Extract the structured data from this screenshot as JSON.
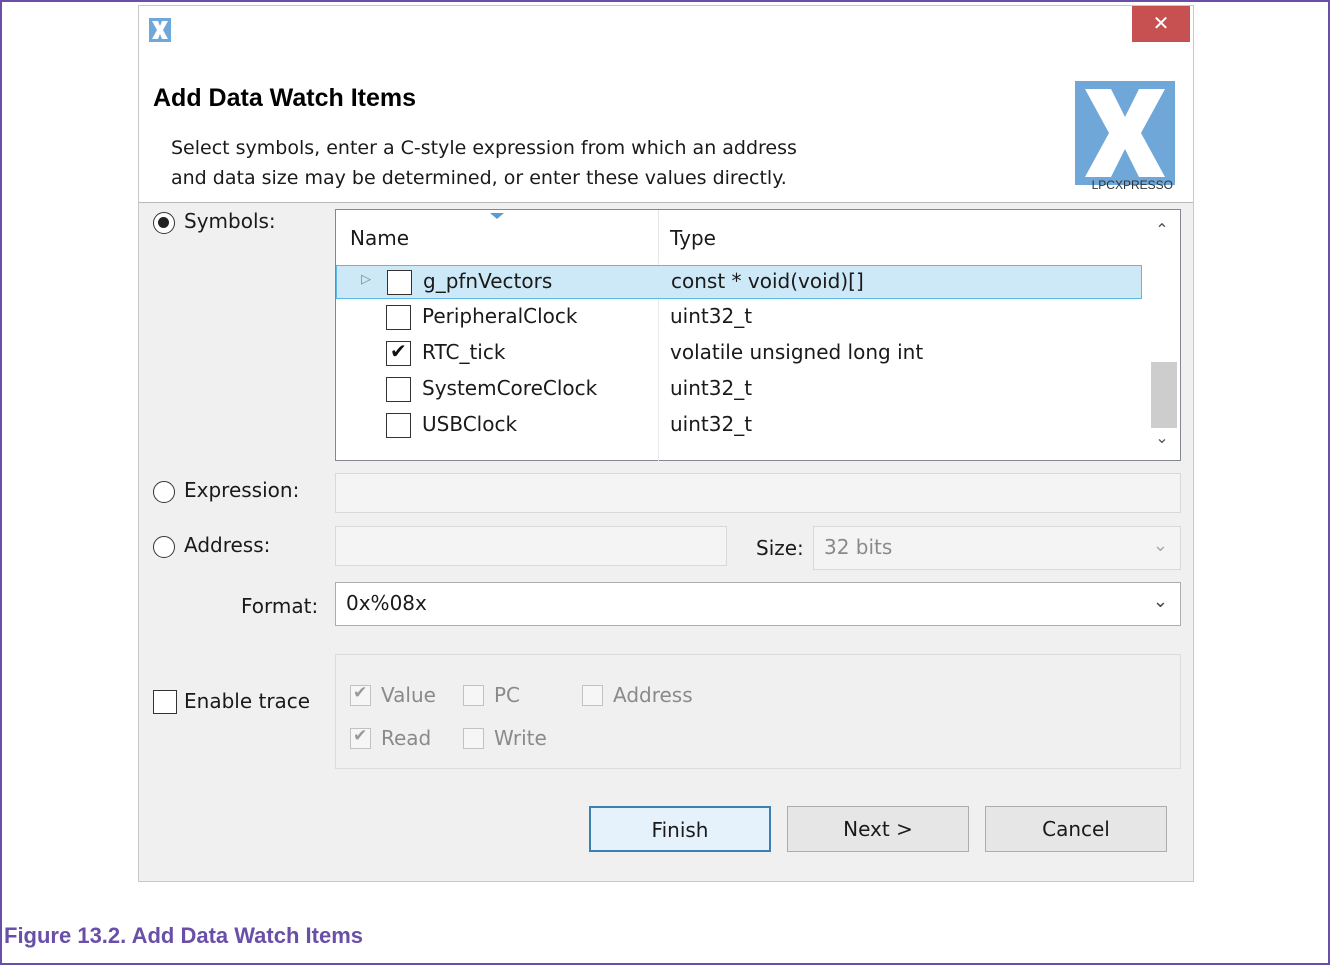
{
  "dialog": {
    "close_glyph": "✕",
    "header": {
      "title": "Add Data Watch Items",
      "description_line1": "Select symbols, enter a C-style expression from which an address",
      "description_line2": "and data size may be determined, or enter these values directly.",
      "brand_text": "LPCXPRESSO",
      "brand_color": "#6fa7d8"
    },
    "symbols": {
      "label": "Symbols:",
      "selected": true,
      "columns": [
        "Name",
        "Type"
      ],
      "rows": [
        {
          "name": "g_pfnVectors",
          "type": "const  * void(void)[]",
          "checked": false,
          "expandable": true,
          "selected": true
        },
        {
          "name": "PeripheralClock",
          "type": "uint32_t",
          "checked": false,
          "expandable": false,
          "selected": false
        },
        {
          "name": "RTC_tick",
          "type": "volatile unsigned long int",
          "checked": true,
          "expandable": false,
          "selected": false
        },
        {
          "name": "SystemCoreClock",
          "type": "uint32_t",
          "checked": false,
          "expandable": false,
          "selected": false
        },
        {
          "name": "USBClock",
          "type": "uint32_t",
          "checked": false,
          "expandable": false,
          "selected": false
        }
      ]
    },
    "expression": {
      "label": "Expression:",
      "value": ""
    },
    "address": {
      "label": "Address:",
      "value": "",
      "size_label": "Size:",
      "size_value": "32 bits"
    },
    "format": {
      "label": "Format:",
      "value": "0x%08x"
    },
    "trace": {
      "label": "Enable trace",
      "enabled": false,
      "options": {
        "value": {
          "label": "Value",
          "checked": true
        },
        "pc": {
          "label": "PC",
          "checked": false
        },
        "address": {
          "label": "Address",
          "checked": false
        },
        "read": {
          "label": "Read",
          "checked": true
        },
        "write": {
          "label": "Write",
          "checked": false
        }
      }
    },
    "buttons": {
      "finish": "Finish",
      "next": "Next >",
      "cancel": "Cancel"
    }
  },
  "caption": "Figure 13.2. Add Data Watch Items",
  "colors": {
    "caption": "#6a4fa8",
    "close": "#c75050",
    "selection": "#cde8f7",
    "accent": "#3c7fb1"
  }
}
